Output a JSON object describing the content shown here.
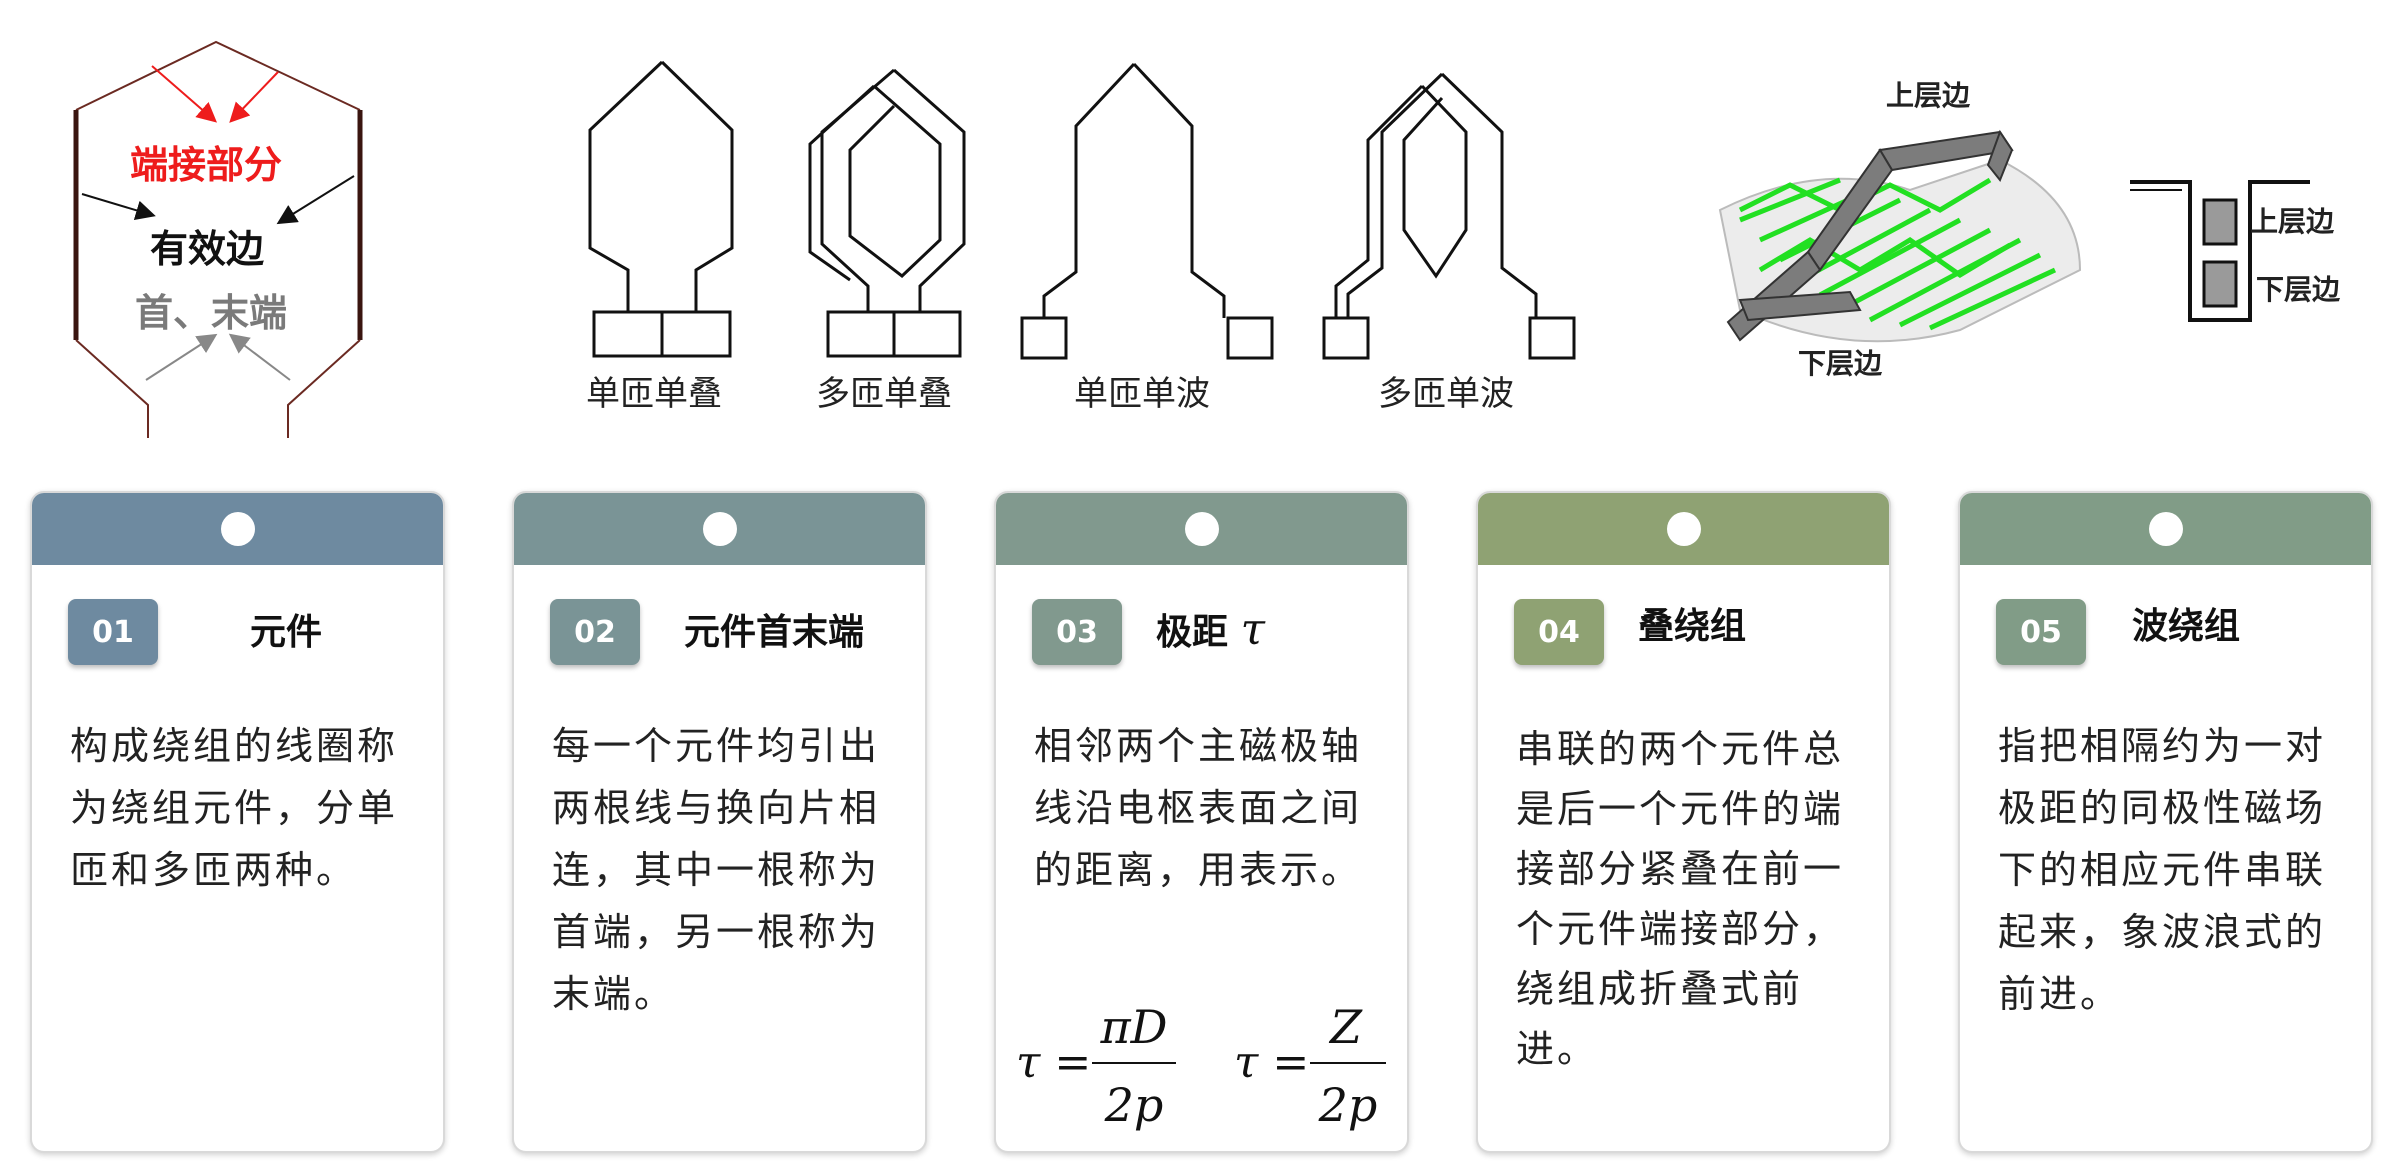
{
  "structure_diagram": {
    "label_end_part": "端接部分",
    "label_effective_side": "有效边",
    "label_ends": "首、末端",
    "color_end_part": "#ee1c1c",
    "color_ends": "#7a7a7a"
  },
  "winding_types": [
    {
      "label": "单匝单叠"
    },
    {
      "label": "多匝单叠"
    },
    {
      "label": "单匝单波"
    },
    {
      "label": "多匝单波"
    }
  ],
  "layer_diagram": {
    "upper_side": "上层边",
    "lower_side": "下层边",
    "slot_upper": "上层边",
    "slot_lower": "下层边",
    "green": "#22e022"
  },
  "cards": [
    {
      "num": "01",
      "title": "元件",
      "color": "#6e8aa0",
      "body": "构成绕组的线圈称为绕组元件，分单匝和多匝两种。"
    },
    {
      "num": "02",
      "title": "元件首末端",
      "color": "#7a9496",
      "body": "每一个元件均引出两根线与换向片相连，其中一根称为首端，另一根称为末端。"
    },
    {
      "num": "03",
      "title": "极距",
      "title_symbol": "τ",
      "color": "#81998e",
      "body": "相邻两个主磁极轴线沿电枢表面之间的距离，用表示。",
      "formula1": {
        "lhs": "τ =",
        "num": "πD",
        "den": "2p"
      },
      "formula2": {
        "lhs": "τ =",
        "num": "Z",
        "den": "2p"
      }
    },
    {
      "num": "04",
      "title": "叠绕组",
      "color": "#8fa273",
      "body": "串联的两个元件总是后一个元件的端接部分紧叠在前一个元件端接部分，绕组成折叠式前进。"
    },
    {
      "num": "05",
      "title": "波绕组",
      "color": "#819c87",
      "body": "指把相隔约为一对极距的同极性磁场下的相应元件串联起来，象波浪式的前进。"
    }
  ]
}
